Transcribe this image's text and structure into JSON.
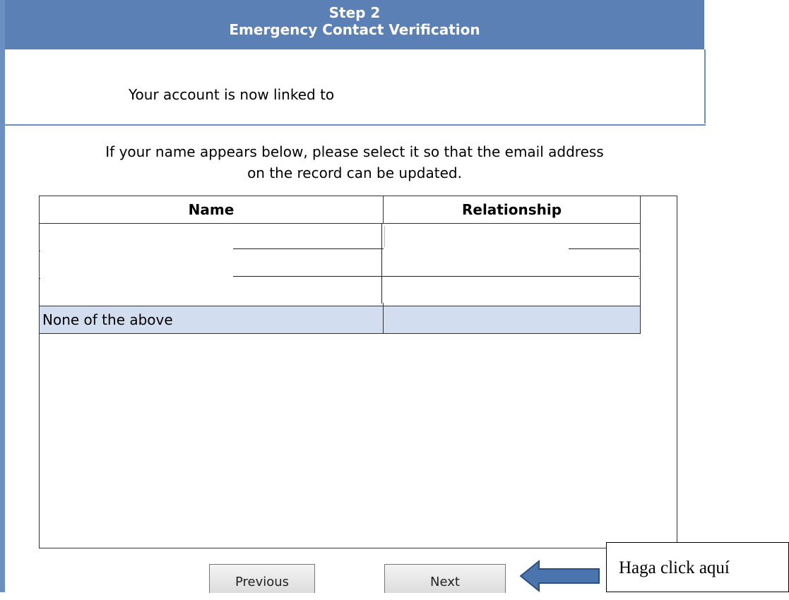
{
  "header": {
    "step": "Step 2",
    "title": "Emergency Contact Verification"
  },
  "linked_text": "Your account is now linked to",
  "instruction": [
    "If your name appears below, please select it so that the email address",
    "on the record can be updated."
  ],
  "table": {
    "columns": [
      "Name",
      "Relationship"
    ],
    "rows": [
      {
        "name": "",
        "relationship": ""
      },
      {
        "name": "",
        "relationship": ""
      },
      {
        "name": "",
        "relationship": ""
      },
      {
        "name": "None of the above",
        "relationship": ""
      }
    ]
  },
  "buttons": {
    "previous": "Previous",
    "next": "Next"
  },
  "callout": "Haga click aquí",
  "colors": {
    "header_bg": "#5b80b6",
    "highlight_row": "#d2deef",
    "arrow": "#4a74ad"
  }
}
